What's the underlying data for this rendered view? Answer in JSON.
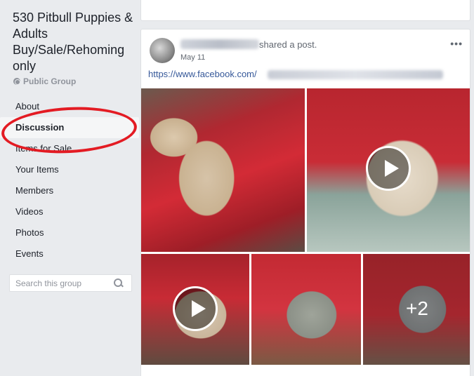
{
  "group": {
    "title": "530 Pitbull Puppies & Adults Buy/Sale/Rehoming only",
    "privacy": "Public Group"
  },
  "nav": {
    "items": [
      {
        "label": "About"
      },
      {
        "label": "Discussion"
      },
      {
        "label": "Items for Sale"
      },
      {
        "label": "Your Items"
      },
      {
        "label": "Members"
      },
      {
        "label": "Videos"
      },
      {
        "label": "Photos"
      },
      {
        "label": "Events"
      }
    ],
    "active": "Discussion"
  },
  "search": {
    "placeholder": "Search this group"
  },
  "post": {
    "action_text": "shared a post.",
    "date": "May 11",
    "link_text": "https://www.facebook.com/",
    "more_label": "•••",
    "extra_photos_label": "+2"
  },
  "icons": {
    "privacy": "globe-icon",
    "search": "search-icon",
    "more": "more-options-icon",
    "video": "play-icon"
  },
  "colors": {
    "annotation": "#e31b23",
    "link": "#365899",
    "background": "#e9ebee"
  }
}
